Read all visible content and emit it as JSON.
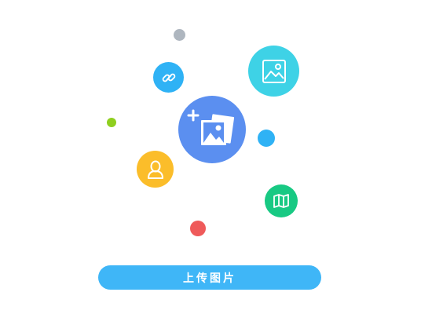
{
  "colors": {
    "dot_gray": "#aeb6bf",
    "dot_green": "#8fcf1f",
    "dot_blue": "#2fb2f5",
    "dot_red": "#ef5a5a",
    "link_bubble": "#2fb2f5",
    "image_bubble": "#3ed2e6",
    "center_bubble": "#5b8ff0",
    "user_bubble": "#fbbd2a",
    "map_bubble": "#18c983",
    "button": "#3fb6f7"
  },
  "icons": {
    "link": "link-icon",
    "image": "image-icon",
    "center": "add-photos-icon",
    "user": "user-icon",
    "map": "map-icon"
  },
  "upload_button": {
    "label": "上传图片"
  }
}
